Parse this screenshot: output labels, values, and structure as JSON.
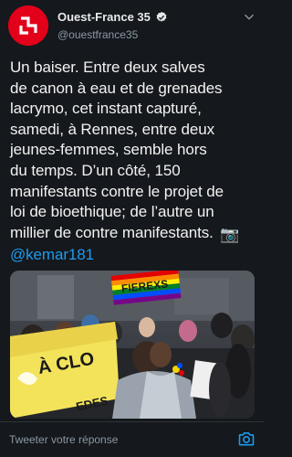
{
  "account": {
    "display_name": "Ouest-France 35",
    "handle": "@ouestfrance35",
    "verified_icon": "verified-badge-icon",
    "avatar_icon": "ouest-france-logo"
  },
  "tweet": {
    "text": "Un baiser. Entre deux salves\nde canon à eau et de grenades\nlacrymo, cet instant capturé,\nsamedi, à Rennes, entre deux\njeunes-femmes, semble hors\ndu temps. D’un côté, 150\nmanifestants contre le projet de\nloi de bioethique; de l’autre  un\nmillier de contre manifestants.",
    "camera_emoji": "📷",
    "mention": "@kemar181"
  },
  "media": {
    "banner_left": "À CLO",
    "banner_left2": "EDES",
    "flag_text": "FIEREXS",
    "accent_colors": [
      "#e40303",
      "#ff8c00",
      "#ffed00",
      "#008026",
      "#004dff",
      "#750787"
    ]
  },
  "reply": {
    "placeholder": "Tweeter votre réponse",
    "photo_icon": "camera-icon"
  },
  "colors": {
    "background": "#15181c",
    "text": "#e7e9ea",
    "secondary": "#8b98a5",
    "accent": "#1d9bf0",
    "brand": "#e2001a"
  }
}
